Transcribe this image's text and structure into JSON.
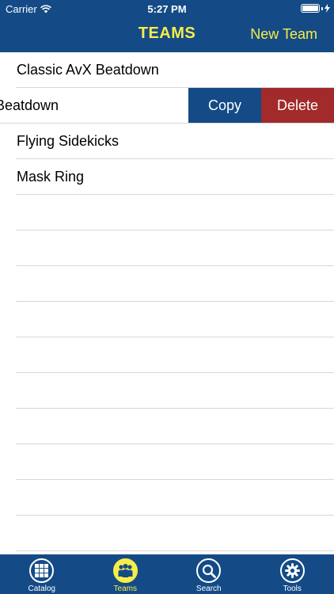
{
  "status_bar": {
    "carrier": "Carrier",
    "time": "5:27 PM",
    "wifi_icon": "wifi-icon",
    "battery_icon": "battery-icon"
  },
  "nav": {
    "title": "TEAMS",
    "action": "New Team"
  },
  "teams": [
    {
      "name": "Classic AvX Beatdown"
    },
    {
      "name": "Beatdown",
      "swiped": true
    },
    {
      "name": "Flying Sidekicks"
    },
    {
      "name": "Mask Ring"
    }
  ],
  "swipe_actions": {
    "copy": "Copy",
    "delete": "Delete"
  },
  "tabs": [
    {
      "label": "Catalog",
      "icon": "grid-icon"
    },
    {
      "label": "Teams",
      "icon": "people-icon",
      "active": true
    },
    {
      "label": "Search",
      "icon": "search-icon"
    },
    {
      "label": "Tools",
      "icon": "gear-icon"
    }
  ],
  "colors": {
    "bar": "#144b86",
    "accent": "#f8ec4a",
    "delete": "#a32a2a"
  }
}
